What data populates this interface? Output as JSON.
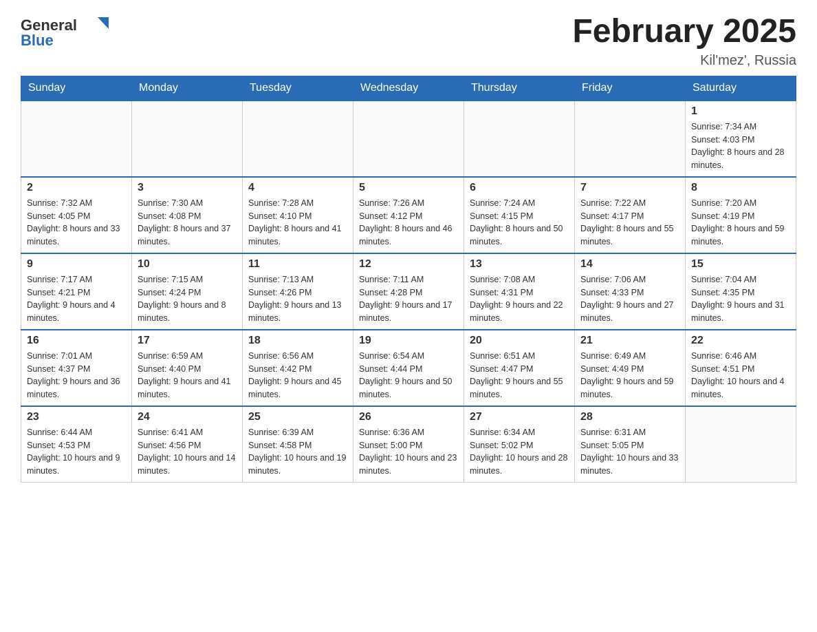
{
  "header": {
    "logo_general": "General",
    "logo_blue": "Blue",
    "month_title": "February 2025",
    "location": "Kil'mez', Russia"
  },
  "weekdays": [
    "Sunday",
    "Monday",
    "Tuesday",
    "Wednesday",
    "Thursday",
    "Friday",
    "Saturday"
  ],
  "weeks": [
    [
      {
        "day": "",
        "info": ""
      },
      {
        "day": "",
        "info": ""
      },
      {
        "day": "",
        "info": ""
      },
      {
        "day": "",
        "info": ""
      },
      {
        "day": "",
        "info": ""
      },
      {
        "day": "",
        "info": ""
      },
      {
        "day": "1",
        "info": "Sunrise: 7:34 AM\nSunset: 4:03 PM\nDaylight: 8 hours and 28 minutes."
      }
    ],
    [
      {
        "day": "2",
        "info": "Sunrise: 7:32 AM\nSunset: 4:05 PM\nDaylight: 8 hours and 33 minutes."
      },
      {
        "day": "3",
        "info": "Sunrise: 7:30 AM\nSunset: 4:08 PM\nDaylight: 8 hours and 37 minutes."
      },
      {
        "day": "4",
        "info": "Sunrise: 7:28 AM\nSunset: 4:10 PM\nDaylight: 8 hours and 41 minutes."
      },
      {
        "day": "5",
        "info": "Sunrise: 7:26 AM\nSunset: 4:12 PM\nDaylight: 8 hours and 46 minutes."
      },
      {
        "day": "6",
        "info": "Sunrise: 7:24 AM\nSunset: 4:15 PM\nDaylight: 8 hours and 50 minutes."
      },
      {
        "day": "7",
        "info": "Sunrise: 7:22 AM\nSunset: 4:17 PM\nDaylight: 8 hours and 55 minutes."
      },
      {
        "day": "8",
        "info": "Sunrise: 7:20 AM\nSunset: 4:19 PM\nDaylight: 8 hours and 59 minutes."
      }
    ],
    [
      {
        "day": "9",
        "info": "Sunrise: 7:17 AM\nSunset: 4:21 PM\nDaylight: 9 hours and 4 minutes."
      },
      {
        "day": "10",
        "info": "Sunrise: 7:15 AM\nSunset: 4:24 PM\nDaylight: 9 hours and 8 minutes."
      },
      {
        "day": "11",
        "info": "Sunrise: 7:13 AM\nSunset: 4:26 PM\nDaylight: 9 hours and 13 minutes."
      },
      {
        "day": "12",
        "info": "Sunrise: 7:11 AM\nSunset: 4:28 PM\nDaylight: 9 hours and 17 minutes."
      },
      {
        "day": "13",
        "info": "Sunrise: 7:08 AM\nSunset: 4:31 PM\nDaylight: 9 hours and 22 minutes."
      },
      {
        "day": "14",
        "info": "Sunrise: 7:06 AM\nSunset: 4:33 PM\nDaylight: 9 hours and 27 minutes."
      },
      {
        "day": "15",
        "info": "Sunrise: 7:04 AM\nSunset: 4:35 PM\nDaylight: 9 hours and 31 minutes."
      }
    ],
    [
      {
        "day": "16",
        "info": "Sunrise: 7:01 AM\nSunset: 4:37 PM\nDaylight: 9 hours and 36 minutes."
      },
      {
        "day": "17",
        "info": "Sunrise: 6:59 AM\nSunset: 4:40 PM\nDaylight: 9 hours and 41 minutes."
      },
      {
        "day": "18",
        "info": "Sunrise: 6:56 AM\nSunset: 4:42 PM\nDaylight: 9 hours and 45 minutes."
      },
      {
        "day": "19",
        "info": "Sunrise: 6:54 AM\nSunset: 4:44 PM\nDaylight: 9 hours and 50 minutes."
      },
      {
        "day": "20",
        "info": "Sunrise: 6:51 AM\nSunset: 4:47 PM\nDaylight: 9 hours and 55 minutes."
      },
      {
        "day": "21",
        "info": "Sunrise: 6:49 AM\nSunset: 4:49 PM\nDaylight: 9 hours and 59 minutes."
      },
      {
        "day": "22",
        "info": "Sunrise: 6:46 AM\nSunset: 4:51 PM\nDaylight: 10 hours and 4 minutes."
      }
    ],
    [
      {
        "day": "23",
        "info": "Sunrise: 6:44 AM\nSunset: 4:53 PM\nDaylight: 10 hours and 9 minutes."
      },
      {
        "day": "24",
        "info": "Sunrise: 6:41 AM\nSunset: 4:56 PM\nDaylight: 10 hours and 14 minutes."
      },
      {
        "day": "25",
        "info": "Sunrise: 6:39 AM\nSunset: 4:58 PM\nDaylight: 10 hours and 19 minutes."
      },
      {
        "day": "26",
        "info": "Sunrise: 6:36 AM\nSunset: 5:00 PM\nDaylight: 10 hours and 23 minutes."
      },
      {
        "day": "27",
        "info": "Sunrise: 6:34 AM\nSunset: 5:02 PM\nDaylight: 10 hours and 28 minutes."
      },
      {
        "day": "28",
        "info": "Sunrise: 6:31 AM\nSunset: 5:05 PM\nDaylight: 10 hours and 33 minutes."
      },
      {
        "day": "",
        "info": ""
      }
    ]
  ]
}
